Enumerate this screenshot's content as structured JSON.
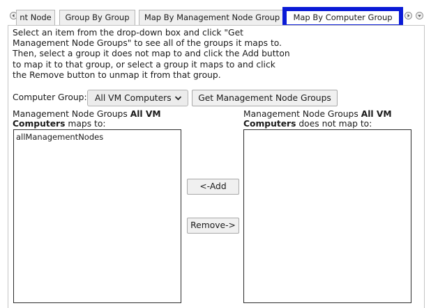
{
  "tabs": {
    "items": [
      {
        "label": "nt Node"
      },
      {
        "label": "Group By Group"
      },
      {
        "label": "Map By Management Node Group"
      },
      {
        "label": "Map By Computer Group"
      }
    ],
    "active_index": 3,
    "scroll_left_icon": "scroll-left-icon",
    "scroll_right_icon": "scroll-right-icon",
    "menu_icon": "dropdown-menu-icon",
    "active_border_color": "#0a1ad6"
  },
  "panel": {
    "instructions": [
      "Select an item from the drop-down box and click \"Get",
      "Management Node Groups\" to see all of the groups it maps to.",
      "Then, select a group it does not map to and click the Add button",
      "to map it to that group, or select a group it maps to and click",
      "the Remove button to unmap it from that group."
    ],
    "computer_group_label": "Computer Group:",
    "computer_group_selected": "All VM Computers",
    "get_button": "Get Management Node Groups",
    "left": {
      "prefix": "Management Node Groups",
      "group_bold_1": "All VM",
      "group_bold_2": "Computers",
      "suffix": "maps to:",
      "items": [
        "allManagementNodes"
      ]
    },
    "right": {
      "prefix": "Management Node Groups",
      "group_bold_1": "All VM",
      "group_bold_2": "Computers",
      "suffix": "does not map to:",
      "items": []
    },
    "add_button": "<-Add",
    "remove_button": "Remove->"
  }
}
